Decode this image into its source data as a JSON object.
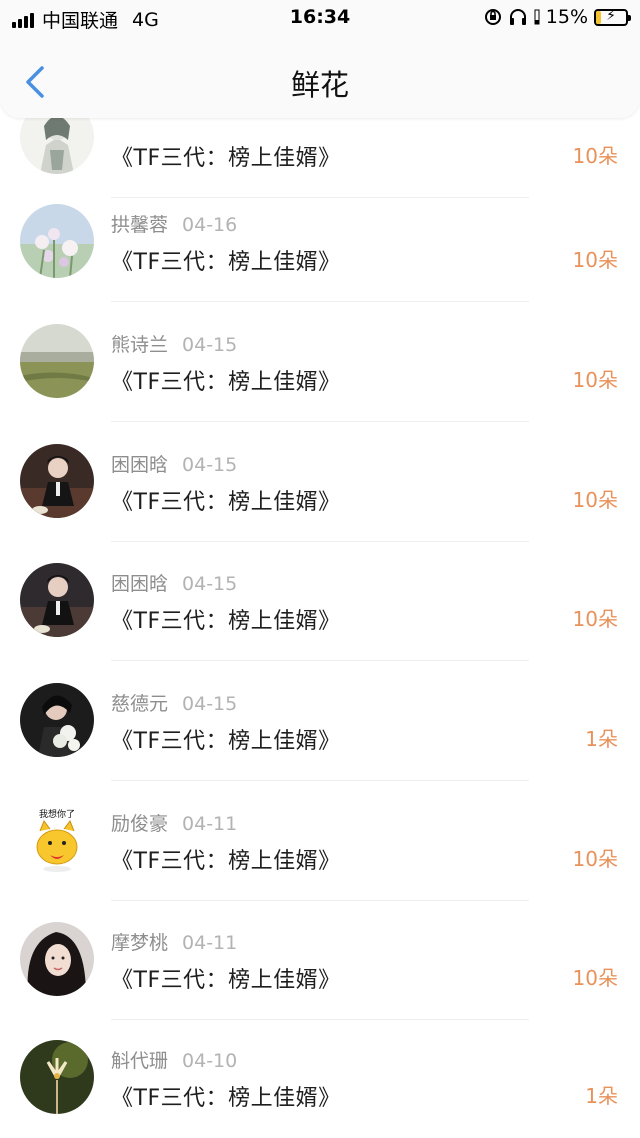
{
  "status_bar": {
    "carrier": "中国联通",
    "network": "4G",
    "time": "16:34",
    "battery_percent": "15%",
    "battery_level": 0.15,
    "icons": [
      "signal-icon",
      "rotation-lock-icon",
      "headphones-icon",
      "battery-icon"
    ]
  },
  "nav": {
    "title": "鲜花",
    "back_icon": "chevron-left-icon"
  },
  "colors": {
    "accent": "#4a90e2",
    "count": "#e8925a",
    "name": "#8e8e8e",
    "date": "#b3b3b3"
  },
  "rows": [
    {
      "name": "",
      "date": "",
      "book": "《TF三代：榜上佳婿》",
      "count": "10朵",
      "avatar": "sketch-avatar"
    },
    {
      "name": "拱馨蓉",
      "date": "04-16",
      "book": "《TF三代：榜上佳婿》",
      "count": "10朵",
      "avatar": "flowers-avatar"
    },
    {
      "name": "熊诗兰",
      "date": "04-15",
      "book": "《TF三代：榜上佳婿》",
      "count": "10朵",
      "avatar": "landscape-avatar"
    },
    {
      "name": "困困晗",
      "date": "04-15",
      "book": "《TF三代：榜上佳婿》",
      "count": "10朵",
      "avatar": "person-avatar"
    },
    {
      "name": "困困晗",
      "date": "04-15",
      "book": "《TF三代：榜上佳婿》",
      "count": "10朵",
      "avatar": "person-avatar"
    },
    {
      "name": "慈德元",
      "date": "04-15",
      "book": "《TF三代：榜上佳婿》",
      "count": "1朵",
      "avatar": "person-flowers-avatar"
    },
    {
      "name": "励俊豪",
      "date": "04-11",
      "book": "《TF三代：榜上佳婿》",
      "count": "10朵",
      "avatar": "cartoon-cat-avatar",
      "sticker_text": "我想你了"
    },
    {
      "name": "摩梦桃",
      "date": "04-11",
      "book": "《TF三代：榜上佳婿》",
      "count": "10朵",
      "avatar": "portrait-avatar"
    },
    {
      "name": "斛代珊",
      "date": "04-10",
      "book": "《TF三代：榜上佳婿》",
      "count": "1朵",
      "avatar": "flower-avatar"
    }
  ]
}
